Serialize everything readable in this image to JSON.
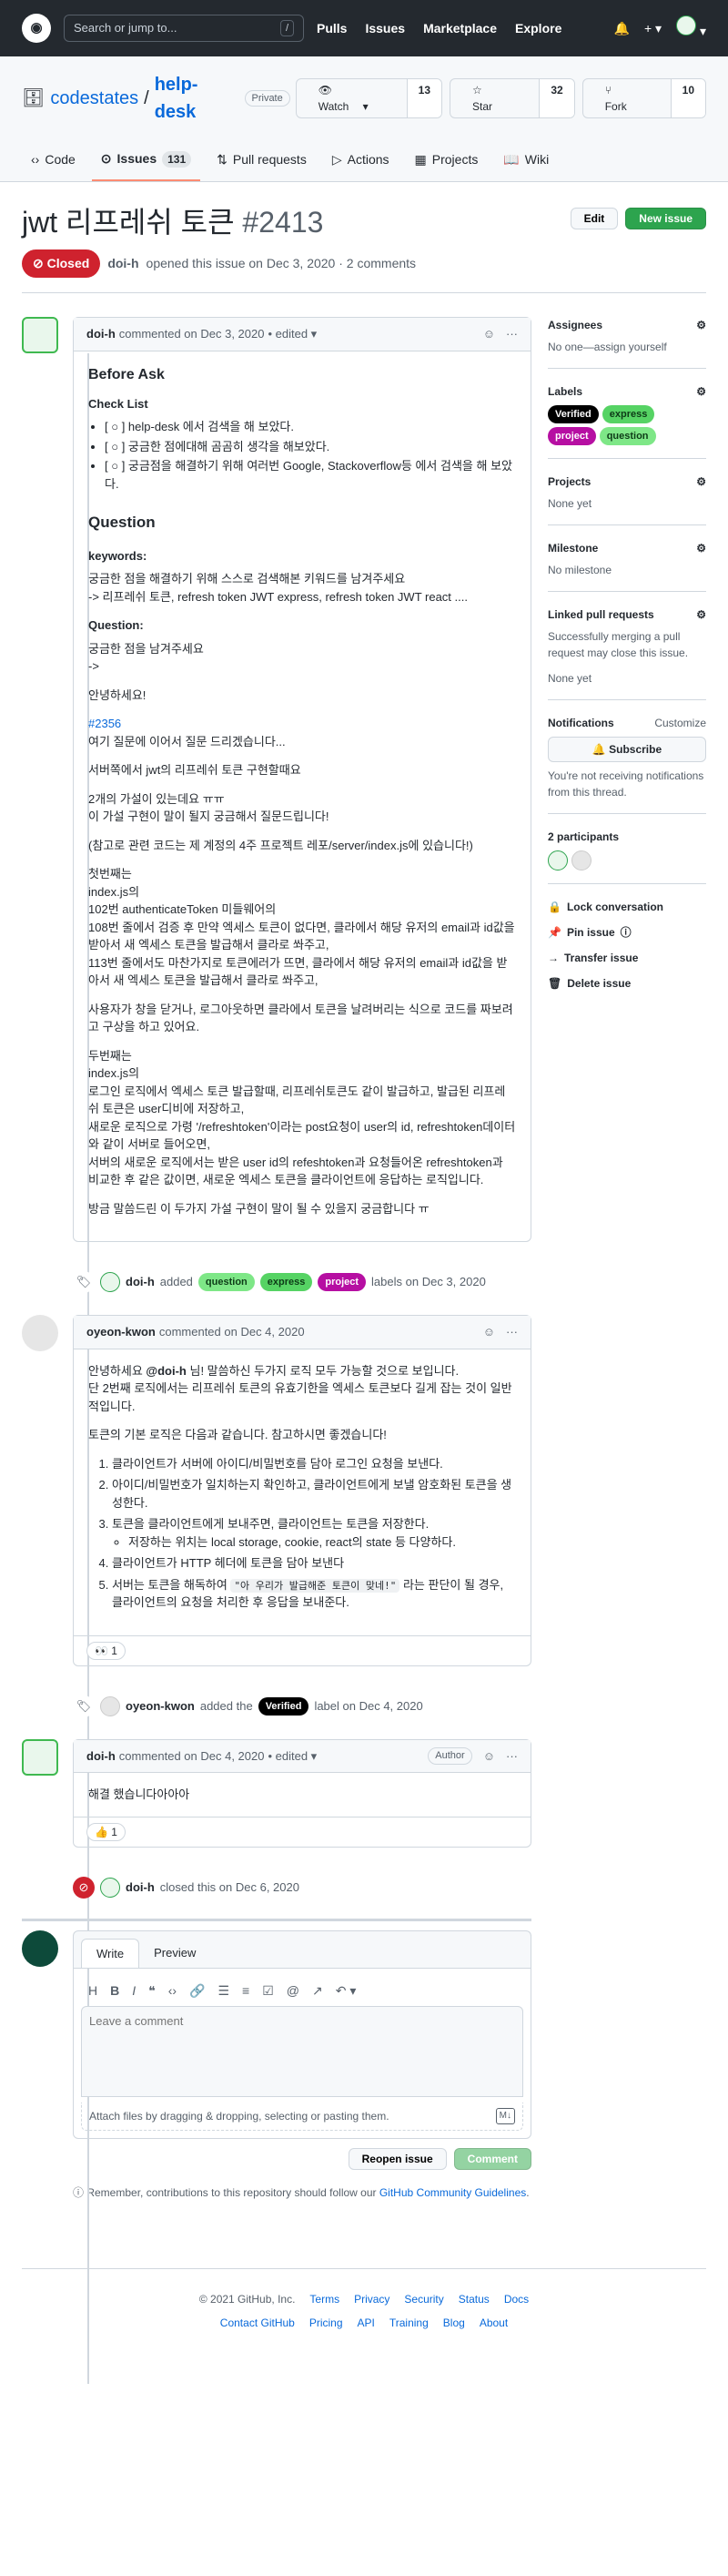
{
  "header": {
    "search_placeholder": "Search or jump to...",
    "slash": "/",
    "nav": [
      "Pulls",
      "Issues",
      "Marketplace",
      "Explore"
    ],
    "logo": "github-icon"
  },
  "repo": {
    "owner": "codestates",
    "sep": "/",
    "name": "help-desk",
    "visibility": "Private",
    "watch_label": "Watch",
    "watch_count": "13",
    "star_label": "Star",
    "star_count": "32",
    "fork_label": "Fork",
    "fork_count": "10",
    "tabs": [
      {
        "label": "Code"
      },
      {
        "label": "Issues",
        "count": "131"
      },
      {
        "label": "Pull requests"
      },
      {
        "label": "Actions"
      },
      {
        "label": "Projects"
      },
      {
        "label": "Wiki"
      }
    ]
  },
  "issue": {
    "title": "jwt 리프레쉬 토큰",
    "number": "#2413",
    "edit_label": "Edit",
    "new_label": "New issue",
    "state": "Closed",
    "author": "doi-h",
    "meta_text": "opened this issue on Dec 3, 2020 · 2 comments"
  },
  "first_comment": {
    "author": "doi-h",
    "meta": "commented on Dec 3, 2020",
    "edited": "• edited ▾",
    "h_before": "Before Ask",
    "h_checklist": "Check List",
    "checks": [
      "[ ○ ] help-desk 에서 검색을 해 보았다.",
      "[ ○ ] 궁금한 점에대해 곰곰히 생각을 해보았다.",
      "[ ○ ] 궁금점을 해결하기 위해 여러번 Google, Stackoverflow등 에서 검색을 해 보았다."
    ],
    "h_question": "Question",
    "kw_title": "keywords:",
    "kw_line1": "궁금한 점을 해결하기 위해 스스로 검색해본 키워드를 남겨주세요",
    "kw_line2": "-> 리프레쉬 토큰, refresh token JWT express, refresh token JWT react ....",
    "q_title": "Question:",
    "q_line1": "궁금한 점을 남겨주세요",
    "q_line2": "->",
    "p_hello": "안녕하세요!",
    "p_link": "#2356",
    "p_link_after": "여기 질문에 이어서 질문 드리겠습니다...",
    "p_impl": "서버쪽에서 jwt의 리프레쉬 토큰 구현할때요",
    "p_two1": "2개의 가설이 있는데요 ㅠㅠ",
    "p_two2": "이 가설 구현이 말이 될지 궁금해서 질문드립니다!",
    "p_ref": "(참고로 관련 코드는 제 계정의 4주 프로젝트 레포/server/index.js에 있습니다!)",
    "first_block": [
      "첫번째는",
      "index.js의",
      "102번 authenticateToken 미들웨어의",
      "108번 줄에서 검증 후 만약 엑세스 토큰이 없다면, 클라에서 해당 유저의 email과 id값을 받아서 새 엑세스 토큰을 발급해서 클라로 쏴주고,",
      "113번 줄에서도 마찬가지로 토큰에러가 뜨면, 클라에서 해당 유저의 email과 id값을 받아서 새 엑세스 토큰을 발급해서 클라로 쏴주고,"
    ],
    "p_logout": "사용자가 창을 닫거나, 로그아웃하면 클라에서 토큰을 날려버리는 식으로 코드를 짜보려고 구상을 하고 있어요.",
    "second_block": [
      "두번째는",
      "index.js의",
      "로그인 로직에서 엑세스 토큰 발급할때, 리프레쉬토큰도 같이 발급하고, 발급된 리프레쉬 토큰은 user디비에 저장하고,",
      "새로운 로직으로 가령 '/refreshtoken'이라는 post요청이 user의 id, refreshtoken데이터와 같이 서버로 들어오면,",
      "서버의 새로운 로직에서는 받은 user id의 refeshtoken과 요청들어온 refreshtoken과 비교한 후 같은 값이면, 새로운 엑세스 토큰을 클라이언트에 응답하는 로직입니다."
    ],
    "p_last": "방금 말씀드린 이 두가지 가설 구현이 말이 될 수 있을지 궁금합니다 ㅠ"
  },
  "events": {
    "labeled": {
      "actor": "doi-h",
      "pre": "added",
      "post": "labels on Dec 3, 2020"
    },
    "verified": {
      "actor": "oyeon-kwon",
      "pre": "added the",
      "post": "label on Dec 4, 2020"
    },
    "closed": {
      "actor": "doi-h",
      "text": "closed this on Dec 6, 2020"
    }
  },
  "second_comment": {
    "author": "oyeon-kwon",
    "meta": "commented on Dec 4, 2020",
    "line1_a": "안녕하세요 ",
    "mention": "@doi-h",
    "line1_b": " 님! 말씀하신 두가지 로직 모두 가능할 것으로 보입니다.",
    "line2": "단 2번째 로직에서는 리프레쉬 토큰의 유효기한을 엑세스 토큰보다 길게 잡는 것이 일반적입니다.",
    "intro": "토큰의 기본 로직은 다음과 같습니다. 참고하시면 좋겠습니다!",
    "steps": [
      "클라이언트가 서버에 아이디/비밀번호를 담아 로그인 요청을 보낸다.",
      "아이디/비밀번호가 일치하는지 확인하고, 클라이언트에게 보낼 암호화된 토큰을 생성한다.",
      "토큰을 클라이언트에게 보내주면, 클라이언트는 토큰을 저장한다."
    ],
    "substep": "저장하는 위치는 local storage, cookie, react의 state 등 다양하다.",
    "step4": "클라이언트가 HTTP 헤더에 토큰을 담아 보낸다",
    "step5_a": "서버는 토큰을 해독하여 ",
    "step5_code": "\"아 우리가 발급해준 토큰이 맞네!\"",
    "step5_b": " 라는 판단이 될 경우, 클라이언트의 요청을 처리한 후 응답을 보내준다.",
    "reaction_emoji": "👀",
    "reaction_count": "1"
  },
  "third_comment": {
    "author": "doi-h",
    "meta": "commented on Dec 4, 2020",
    "edited": "• edited ▾",
    "role": "Author",
    "body": "해결 했습니다아아아",
    "reaction_emoji": "👍",
    "reaction_count": "1"
  },
  "labels": [
    {
      "name": "Verified",
      "bg": "#000000",
      "fg": "#ffffff"
    },
    {
      "name": "express",
      "bg": "#56d364",
      "fg": "#0d3b17"
    },
    {
      "name": "project",
      "bg": "#b60fa2",
      "fg": "#ffffff"
    },
    {
      "name": "question",
      "bg": "#7ee787",
      "fg": "#0d3b17"
    }
  ],
  "event_labels": [
    "question",
    "express",
    "project"
  ],
  "sidebar": {
    "assignees_h": "Assignees",
    "assignees_v": "No one—assign yourself",
    "labels_h": "Labels",
    "projects_h": "Projects",
    "projects_v": "None yet",
    "milestone_h": "Milestone",
    "milestone_v": "No milestone",
    "linked_h": "Linked pull requests",
    "linked_desc": "Successfully merging a pull request may close this issue.",
    "linked_v": "None yet",
    "notif_h": "Notifications",
    "customize": "Customize",
    "subscribe": "Subscribe",
    "notif_desc": "You're not receiving notifications from this thread.",
    "participants_h": "2 participants",
    "lock": "Lock conversation",
    "pin": "Pin issue",
    "transfer": "Transfer issue",
    "delete": "Delete issue"
  },
  "composer": {
    "tab_write": "Write",
    "tab_preview": "Preview",
    "placeholder": "Leave a comment",
    "attach": "Attach files by dragging & dropping, selecting or pasting them.",
    "md": "M↓",
    "reopen": "Reopen issue",
    "comment": "Comment"
  },
  "tip": {
    "text": "Remember, contributions to this repository should follow our ",
    "link": "GitHub Community Guidelines",
    "end": "."
  },
  "footer": {
    "copy": "© 2021 GitHub, Inc.",
    "row1": [
      "Terms",
      "Privacy",
      "Security",
      "Status",
      "Docs"
    ],
    "row2": [
      "Contact GitHub",
      "Pricing",
      "API",
      "Training",
      "Blog",
      "About"
    ]
  }
}
